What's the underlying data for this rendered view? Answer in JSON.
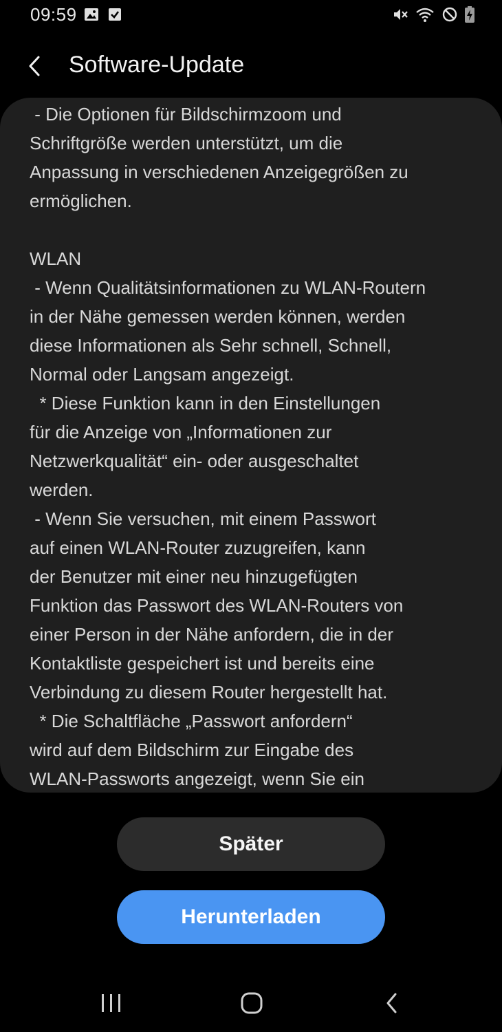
{
  "status_bar": {
    "time": "09:59",
    "left_icons": [
      "image-icon",
      "checkbox-icon"
    ],
    "right_icons": [
      "mute-icon",
      "wifi-icon",
      "do-not-disturb-icon",
      "battery-charging-icon"
    ]
  },
  "app_bar": {
    "back_icon": "chevron-left-icon",
    "title": "Software-Update"
  },
  "release_notes": {
    "text": " - Die Optionen für Bildschirmzoom und\nSchriftgröße werden unterstützt, um die\nAnpassung in verschiedenen Anzeigegrößen zu\nermöglichen.\n\nWLAN\n - Wenn Qualitätsinformationen zu WLAN-Routern\nin der Nähe gemessen werden können, werden\ndiese Informationen als Sehr schnell, Schnell,\nNormal oder Langsam angezeigt.\n  * Diese Funktion kann in den Einstellungen\nfür die Anzeige von „Informationen zur\nNetzwerkqualität“ ein- oder ausgeschaltet\nwerden.\n - Wenn Sie versuchen, mit einem Passwort\nauf einen WLAN-Router zuzugreifen, kann\nder Benutzer mit einer neu hinzugefügten\nFunktion das Passwort des WLAN-Routers von\neiner Person in der Nähe anfordern, die in der\nKontaktliste gespeichert ist und bereits eine\nVerbindung zu diesem Router hergestellt hat.\n  * Die Schaltfläche „Passwort anfordern“\nwird auf dem Bildschirm zur Eingabe des\nWLAN-Passworts angezeigt, wenn Sie ein"
  },
  "actions": {
    "later_label": "Später",
    "download_label": "Herunterladen"
  },
  "colors": {
    "background": "#000000",
    "card": "#1f1f1f",
    "later_button": "#2c2c2c",
    "download_button": "#4a95f2"
  },
  "nav_bar": {
    "icons": [
      "recents-icon",
      "home-icon",
      "back-icon"
    ]
  }
}
